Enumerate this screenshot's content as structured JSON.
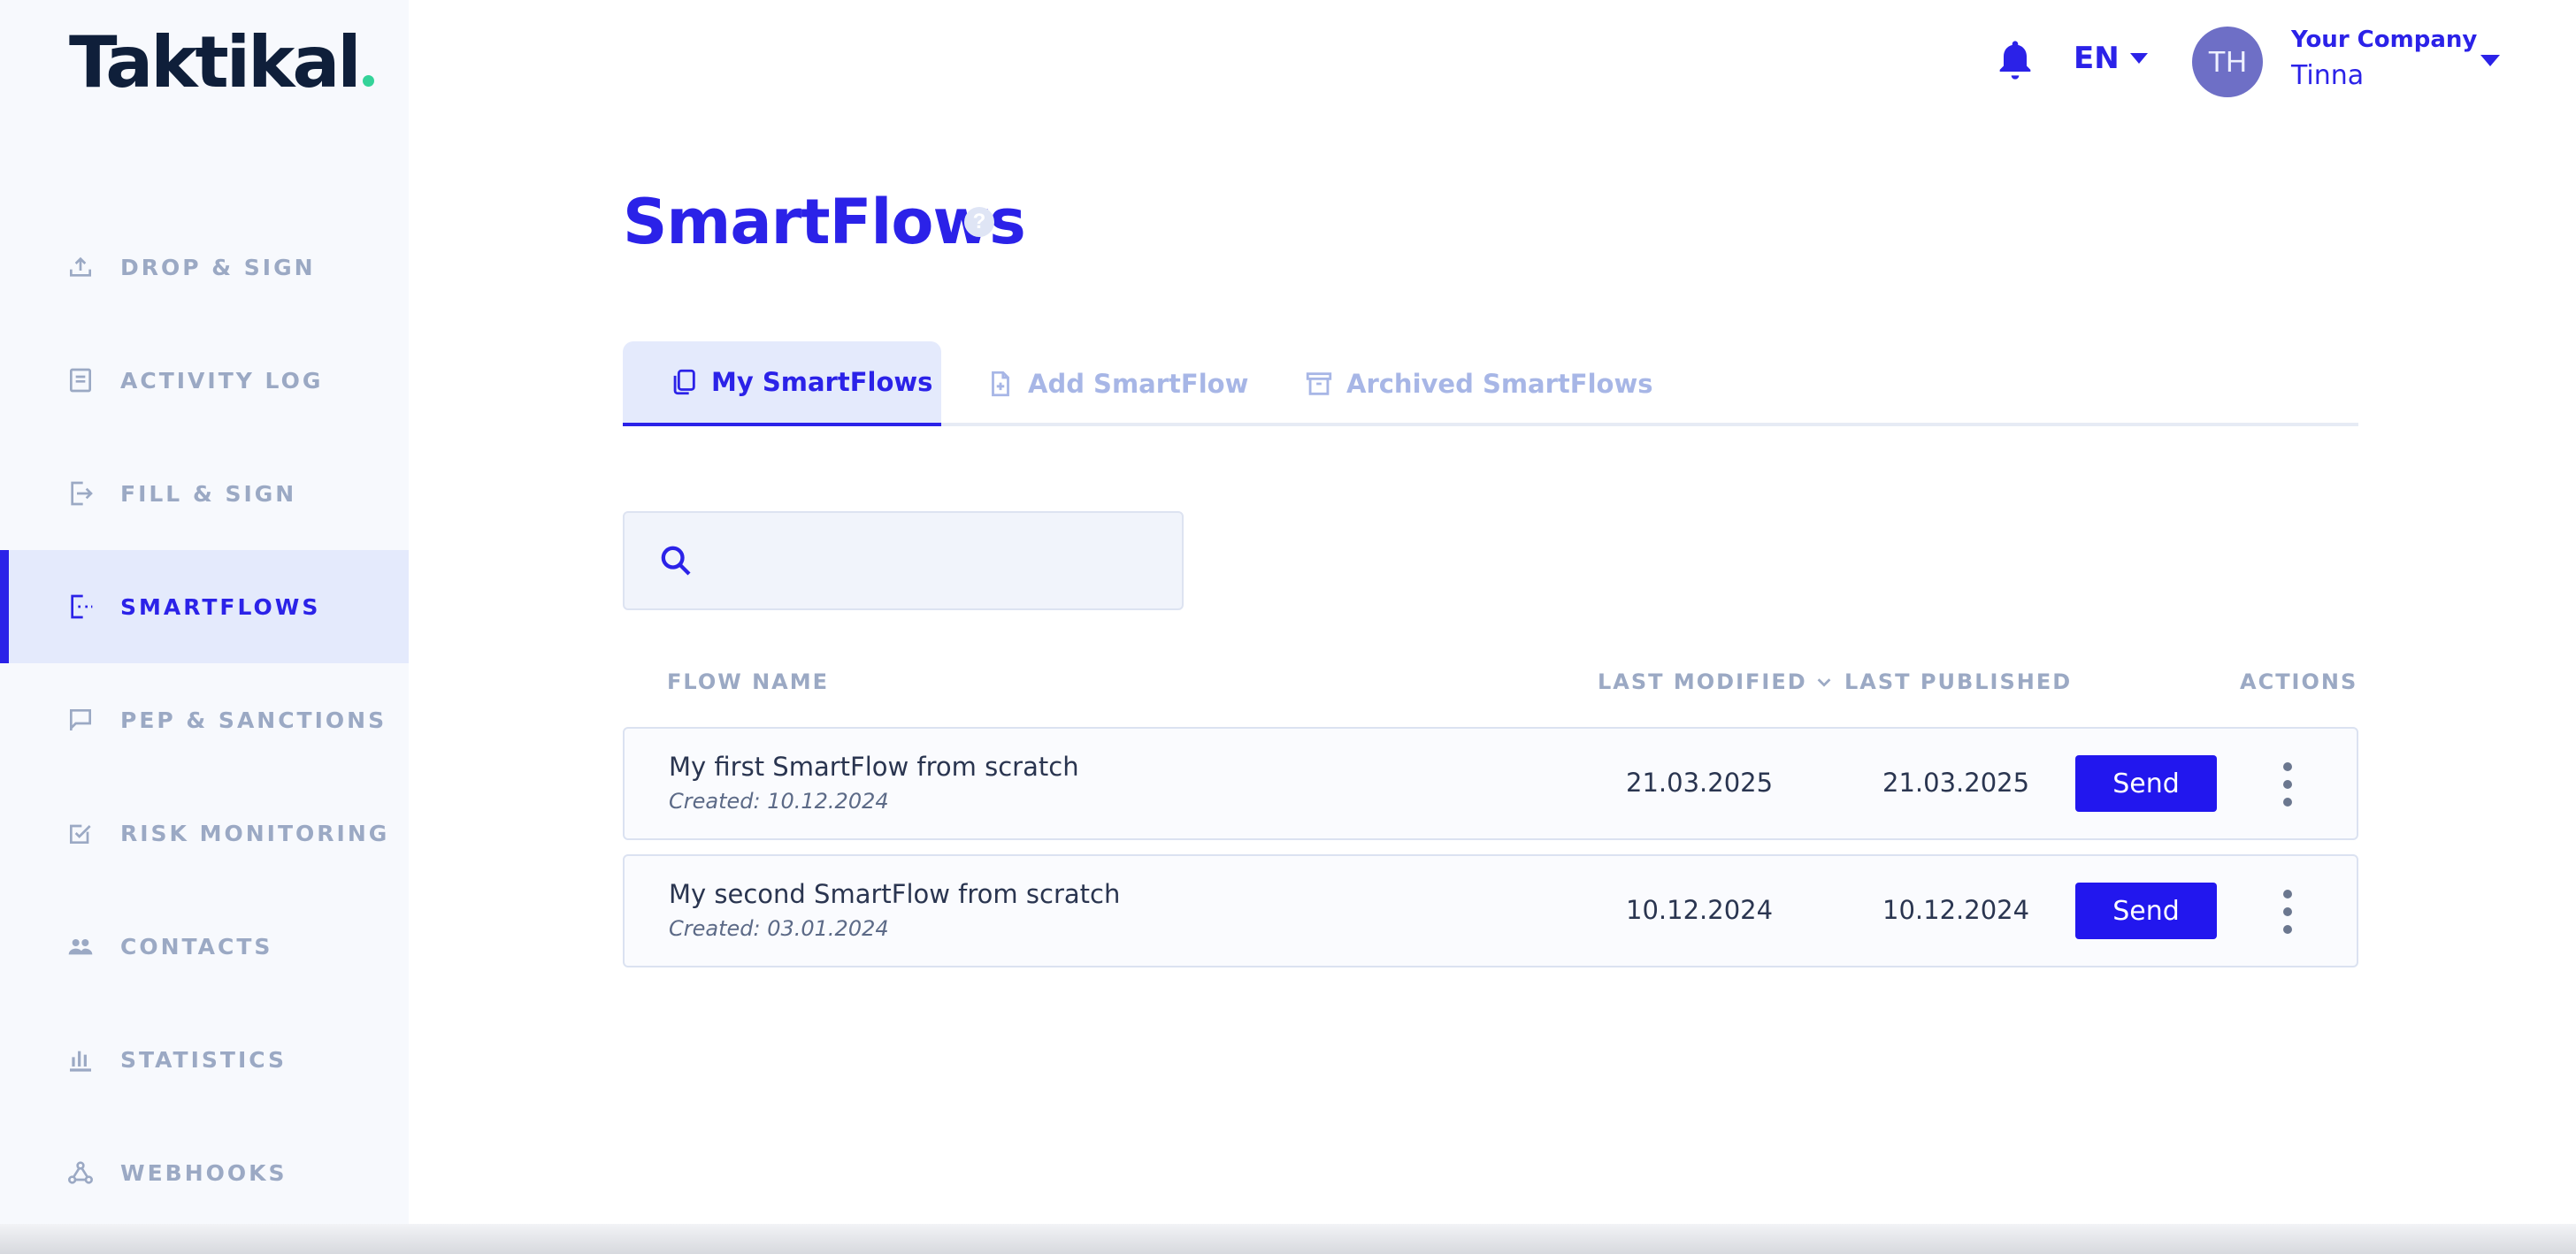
{
  "brand": {
    "logo_text": "Taktikal",
    "dot_color": "#34d399"
  },
  "header": {
    "language": "EN",
    "avatar_initials": "TH",
    "company": "Your Company",
    "user": "Tinna"
  },
  "sidebar": {
    "active_color": "#2b22e8",
    "items": [
      {
        "label": "DROP & SIGN",
        "icon": "upload-icon"
      },
      {
        "label": "ACTIVITY LOG",
        "icon": "document-list-icon"
      },
      {
        "label": "FILL & SIGN",
        "icon": "form-sign-icon"
      },
      {
        "label": "SMARTFLOWS",
        "icon": "smartflow-icon",
        "active": true
      },
      {
        "label": "PEP & SANCTIONS",
        "icon": "flag-icon"
      },
      {
        "label": "RISK MONITORING",
        "icon": "checklist-icon"
      },
      {
        "label": "CONTACTS",
        "icon": "people-icon"
      },
      {
        "label": "STATISTICS",
        "icon": "bar-chart-icon"
      },
      {
        "label": "WEBHOOKS",
        "icon": "webhook-icon"
      }
    ]
  },
  "main": {
    "title": "SmartFlows",
    "help": "?",
    "tabs": [
      {
        "label": "My SmartFlows",
        "icon": "copy-documents-icon",
        "active": true
      },
      {
        "label": "Add SmartFlow",
        "icon": "add-document-icon"
      },
      {
        "label": "Archived SmartFlows",
        "icon": "archive-icon"
      }
    ],
    "search": {
      "placeholder": "",
      "value": ""
    },
    "table": {
      "columns": {
        "name": "FLOW NAME",
        "modified": "LAST MODIFIED",
        "published": "LAST PUBLISHED",
        "actions": "ACTIONS"
      },
      "rows": [
        {
          "name": "My first SmartFlow from scratch",
          "created": "Created: 10.12.2024",
          "last_modified": "21.03.2025",
          "last_published": "21.03.2025",
          "action_label": "Send"
        },
        {
          "name": "My second SmartFlow from scratch",
          "created": "Created: 03.01.2024",
          "last_modified": "10.12.2024",
          "last_published": "10.12.2024",
          "action_label": "Send"
        }
      ]
    }
  }
}
